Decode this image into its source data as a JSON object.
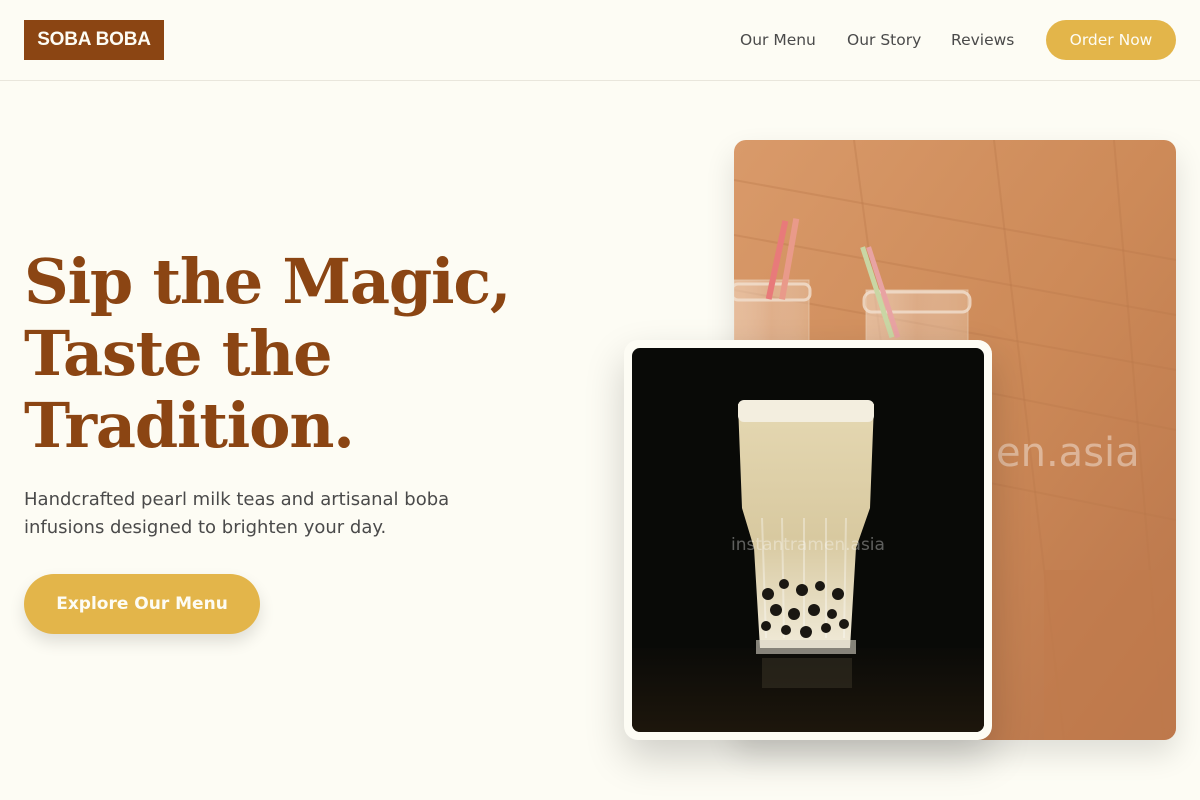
{
  "header": {
    "logo": "SOBA BOBA",
    "nav": [
      {
        "label": "Our Menu"
      },
      {
        "label": "Our Story"
      },
      {
        "label": "Reviews"
      }
    ],
    "order_button": "Order Now"
  },
  "hero": {
    "title_lines": [
      "Sip the Magic,",
      "Taste the",
      "Tradition."
    ],
    "subtitle": "Handcrafted pearl milk teas and artisanal boba infusions designed to brighten your day.",
    "cta": "Explore Our Menu"
  },
  "images": {
    "back_photo": {
      "subject": "bottles-with-straws-on-wood",
      "watermark": "instantramen.asia"
    },
    "front_photo": {
      "subject": "pearl-milk-tea-glass",
      "watermark": "instantramen.asia"
    }
  },
  "colors": {
    "brand": "#8b4513",
    "accent": "#e3b54a",
    "background": "#fdfcf4",
    "text": "#4a4a4a"
  }
}
